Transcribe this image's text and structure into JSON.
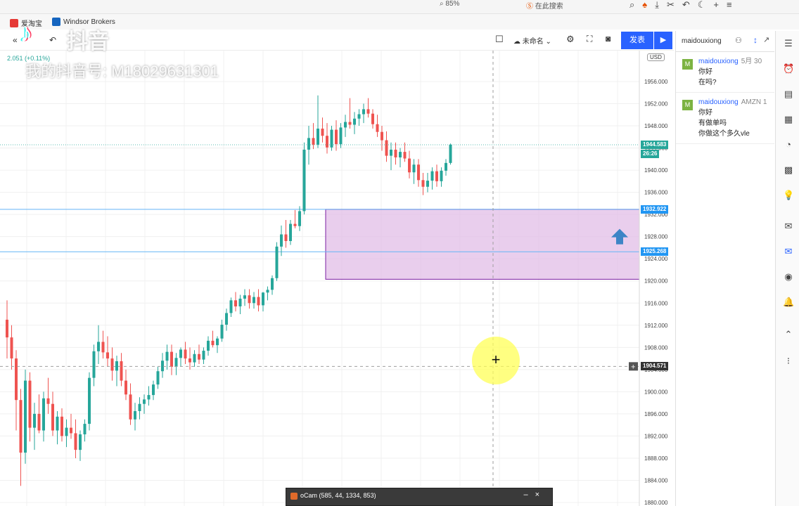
{
  "browser": {
    "zoom": "85%",
    "search_label": "在此搜索"
  },
  "bookmarks": [
    {
      "label": "爱淘宝",
      "color": "#e53935"
    },
    {
      "label": "Windsor Brokers",
      "color": "#1565c0"
    }
  ],
  "watermark": {
    "logo": "♪",
    "brand": "抖音",
    "account_id": "我的抖音号: M18029631301"
  },
  "toolbar": {
    "layout_name": "未命名",
    "publish_label": "发表",
    "play_icon": "play-icon"
  },
  "chart_header": {
    "change": "2.051 (+0.11%)",
    "currency": "USD"
  },
  "chart_data": {
    "type": "candlestick",
    "ylim": [
      1880,
      1960
    ],
    "y_ticks": [
      "1956.000",
      "1952.000",
      "1948.000",
      "1944.000",
      "1940.000",
      "1936.000",
      "1932.000",
      "1928.000",
      "1924.000",
      "1920.000",
      "1916.000",
      "1912.000",
      "1908.000",
      "1904.000",
      "1900.000",
      "1896.000",
      "1892.000",
      "1888.000",
      "1884.000",
      "1880.000"
    ],
    "price_labels": [
      {
        "value": "1944.583",
        "price": 1944.583,
        "color": "#26a69a"
      },
      {
        "value": "26:26",
        "price": 1942.9,
        "color": "#26a69a"
      },
      {
        "value": "1932.922",
        "price": 1932.922,
        "color": "#2196f3"
      },
      {
        "value": "1925.268",
        "price": 1925.268,
        "color": "#2196f3"
      },
      {
        "value": "1904.571",
        "price": 1904.571,
        "color": "#333333"
      }
    ],
    "zone": {
      "top": 1932.922,
      "bottom": 1920.3,
      "start_index": 70
    },
    "h_lines": [
      1932.922,
      1925.268
    ],
    "current_price": 1944.583,
    "crosshair_price": 1904.571,
    "up_arrow_price": 1928.0,
    "up_arrow_index": 134,
    "candles": [
      [
        1913,
        1916.5,
        1906,
        1909.8
      ],
      [
        1909.8,
        1912,
        1904,
        1906
      ],
      [
        1906,
        1907.5,
        1893,
        1898.5
      ],
      [
        1898.5,
        1900.5,
        1883,
        1889
      ],
      [
        1889,
        1904,
        1887,
        1902
      ],
      [
        1902,
        1903.5,
        1891,
        1893.5
      ],
      [
        1893.5,
        1898,
        1889.5,
        1896
      ],
      [
        1896,
        1899.5,
        1892.5,
        1893
      ],
      [
        1893,
        1900,
        1891,
        1898.8
      ],
      [
        1898.8,
        1902.5,
        1896,
        1897.8
      ],
      [
        1897.8,
        1900,
        1892,
        1893
      ],
      [
        1893,
        1896.5,
        1890.5,
        1895.5
      ],
      [
        1895.5,
        1897,
        1891,
        1892
      ],
      [
        1892,
        1895,
        1890,
        1893.5
      ],
      [
        1893.5,
        1896,
        1891.5,
        1892.5
      ],
      [
        1892.5,
        1895,
        1888,
        1889.5
      ],
      [
        1889.5,
        1893,
        1887.5,
        1892.3
      ],
      [
        1892.3,
        1895,
        1891,
        1894.2
      ],
      [
        1894.2,
        1903.5,
        1893,
        1902.5
      ],
      [
        1902.5,
        1908.5,
        1901,
        1907.3
      ],
      [
        1907.3,
        1912,
        1905,
        1909
      ],
      [
        1909,
        1911,
        1906,
        1907.1
      ],
      [
        1907.1,
        1910,
        1904.5,
        1906
      ],
      [
        1906,
        1908,
        1902,
        1903.8
      ],
      [
        1903.8,
        1906.5,
        1901,
        1905.5
      ],
      [
        1905.5,
        1907,
        1901,
        1902
      ],
      [
        1902,
        1904,
        1898.5,
        1899.5
      ],
      [
        1899.5,
        1901.5,
        1894,
        1895
      ],
      [
        1895,
        1898,
        1893,
        1896.5
      ],
      [
        1896.5,
        1899,
        1895,
        1897.8
      ],
      [
        1897.8,
        1899.5,
        1896,
        1898.6
      ],
      [
        1898.6,
        1901,
        1897.5,
        1899.4
      ],
      [
        1899.4,
        1902,
        1898.5,
        1901.3
      ],
      [
        1901.3,
        1904.5,
        1900.5,
        1903.7
      ],
      [
        1903.7,
        1907,
        1902.5,
        1905.6
      ],
      [
        1905.6,
        1908.5,
        1904,
        1907.2
      ],
      [
        1907.2,
        1908.5,
        1903,
        1904.5
      ],
      [
        1904.5,
        1907,
        1903,
        1906.1
      ],
      [
        1906.1,
        1908,
        1904.5,
        1907.6
      ],
      [
        1907.6,
        1909,
        1905,
        1906
      ],
      [
        1906,
        1908,
        1904,
        1905.3
      ],
      [
        1905.3,
        1907.5,
        1904.5,
        1906.8
      ],
      [
        1906.8,
        1908.5,
        1905,
        1905.8
      ],
      [
        1905.8,
        1908,
        1905,
        1907.4
      ],
      [
        1907.4,
        1910,
        1906.5,
        1909.2
      ],
      [
        1909.2,
        1911,
        1908,
        1908.4
      ],
      [
        1908.4,
        1910,
        1907,
        1909.6
      ],
      [
        1909.6,
        1913,
        1909,
        1912.1
      ],
      [
        1912.1,
        1915,
        1911,
        1914.2
      ],
      [
        1914.2,
        1917,
        1913.5,
        1916.5
      ],
      [
        1916.5,
        1918,
        1914.5,
        1915.4
      ],
      [
        1915.4,
        1917.5,
        1914,
        1916.8
      ],
      [
        1916.8,
        1918.5,
        1915.5,
        1917.4
      ],
      [
        1917.4,
        1918.5,
        1915,
        1916
      ],
      [
        1916,
        1918,
        1915,
        1917.1
      ],
      [
        1917.1,
        1918.5,
        1914.5,
        1915.6
      ],
      [
        1915.6,
        1918,
        1914.5,
        1917.9
      ],
      [
        1917.9,
        1919,
        1916.5,
        1918.4
      ],
      [
        1918.4,
        1921,
        1917.5,
        1920.5
      ],
      [
        1920.5,
        1927,
        1920,
        1926.2
      ],
      [
        1926.2,
        1930,
        1924.5,
        1928.4
      ],
      [
        1928.4,
        1931,
        1926,
        1927.2
      ],
      [
        1927.2,
        1931,
        1926.5,
        1930.3
      ],
      [
        1930.3,
        1932.8,
        1929.5,
        1929.9
      ],
      [
        1929.9,
        1933.5,
        1929,
        1932.6
      ],
      [
        1932.6,
        1945,
        1932,
        1943.7
      ],
      [
        1943.7,
        1948,
        1941,
        1945.8
      ],
      [
        1945.8,
        1948.5,
        1943.8,
        1944.6
      ],
      [
        1944.6,
        1953.5,
        1944,
        1947.5
      ],
      [
        1947.5,
        1949.5,
        1945,
        1946.2
      ],
      [
        1946.2,
        1948.5,
        1943,
        1944.1
      ],
      [
        1944.1,
        1948,
        1943.5,
        1947.3
      ],
      [
        1947.3,
        1949,
        1943.5,
        1944.7
      ],
      [
        1944.7,
        1948.5,
        1944,
        1947.7
      ],
      [
        1947.7,
        1950,
        1946,
        1948.7
      ],
      [
        1948.7,
        1953,
        1947.5,
        1948.2
      ],
      [
        1948.2,
        1950.5,
        1946.5,
        1949.3
      ],
      [
        1949.3,
        1951,
        1948,
        1950.1
      ],
      [
        1950.1,
        1952,
        1948.5,
        1951
      ],
      [
        1951,
        1953,
        1949.5,
        1950.2
      ],
      [
        1950.2,
        1951,
        1947.5,
        1948.3
      ],
      [
        1948.3,
        1950,
        1946,
        1946.9
      ],
      [
        1946.9,
        1948,
        1943.5,
        1945.4
      ],
      [
        1945.4,
        1947,
        1941.5,
        1942.6
      ],
      [
        1942.6,
        1945,
        1940,
        1943.7
      ],
      [
        1943.7,
        1945,
        1941,
        1942.3
      ],
      [
        1942.3,
        1944,
        1940.5,
        1943.3
      ],
      [
        1943.3,
        1945,
        1941.5,
        1942.1
      ],
      [
        1942.1,
        1943.5,
        1938.5,
        1939.6
      ],
      [
        1939.6,
        1942,
        1937.5,
        1941
      ],
      [
        1941,
        1942,
        1937,
        1938.2
      ],
      [
        1938.2,
        1939.5,
        1935.5,
        1937
      ],
      [
        1937,
        1939.5,
        1936,
        1938.1
      ],
      [
        1938.1,
        1940.5,
        1936.5,
        1939.8
      ],
      [
        1939.8,
        1941,
        1937,
        1938
      ],
      [
        1938,
        1940.5,
        1937,
        1939.9
      ],
      [
        1939.9,
        1942,
        1939,
        1941.3
      ],
      [
        1941.3,
        1944.8,
        1941,
        1944.6
      ]
    ]
  },
  "chat": {
    "username": "maidouxiong",
    "messages": [
      {
        "avatar": "M",
        "user": "maidouxiong",
        "meta": "5月 30",
        "lines": [
          "你好",
          "在吗?"
        ]
      },
      {
        "avatar": "M",
        "user": "maidouxiong",
        "meta": "AMZN 1",
        "lines": [
          "你好",
          "有做单吗",
          "你做这个多久vle"
        ]
      }
    ]
  },
  "ocam": {
    "title": "oCam (585, 44, 1334, 853)"
  },
  "colors": {
    "up": "#26a69a",
    "down": "#ef5350",
    "zone_fill": "#e1bee7",
    "zone_border": "#7b1fa2",
    "level_line": "#64b5f6",
    "accent": "#2962ff"
  }
}
